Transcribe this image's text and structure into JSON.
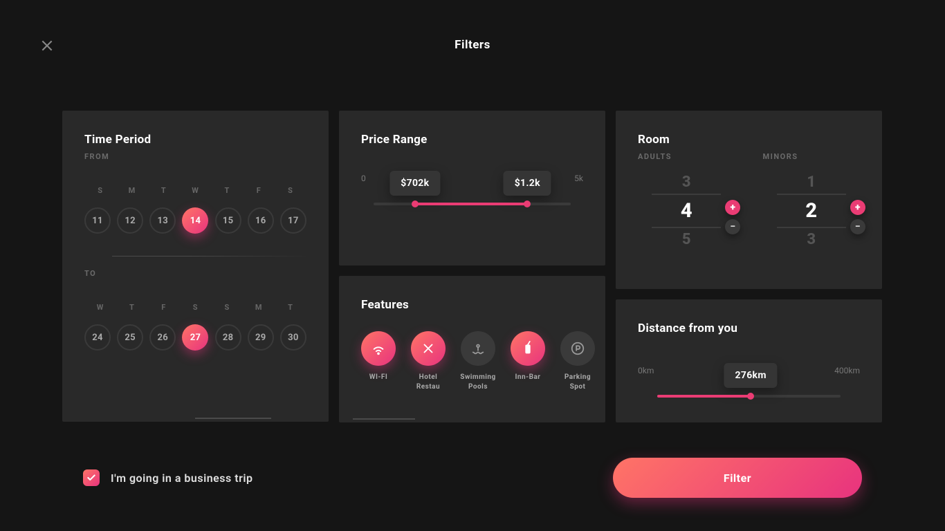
{
  "header": {
    "title": "Filters"
  },
  "timePeriod": {
    "title": "Time Period",
    "fromLabel": "FROM",
    "toLabel": "TO",
    "fromDows": [
      "S",
      "M",
      "T",
      "W",
      "T",
      "F",
      "S"
    ],
    "fromDays": [
      "11",
      "12",
      "13",
      "14",
      "15",
      "16",
      "17"
    ],
    "fromSelectedIndex": 3,
    "toDows": [
      "W",
      "T",
      "F",
      "S",
      "S",
      "M",
      "T"
    ],
    "toDays": [
      "24",
      "25",
      "26",
      "27",
      "28",
      "29",
      "30"
    ],
    "toSelectedIndex": 3
  },
  "priceRange": {
    "title": "Price Range",
    "minLabel": "0",
    "maxLabel": "5k",
    "lowValue": "$702k",
    "highValue": "$1.2k",
    "lowPercent": 21,
    "highPercent": 78
  },
  "features": {
    "title": "Features",
    "items": [
      {
        "label": "WI-FI",
        "on": true,
        "icon": "wifi"
      },
      {
        "label": "Hotel Restau",
        "on": true,
        "icon": "restaurant"
      },
      {
        "label": "Swimming Pools",
        "on": false,
        "icon": "pool"
      },
      {
        "label": "Inn-Bar",
        "on": true,
        "icon": "drink"
      },
      {
        "label": "Parking Spot",
        "on": false,
        "icon": "parking"
      }
    ]
  },
  "room": {
    "title": "Room",
    "adultsLabel": "ADULTS",
    "minorsLabel": "MINORS",
    "adults": {
      "prev": "3",
      "current": "4",
      "next": "5"
    },
    "minors": {
      "prev": "1",
      "current": "2",
      "next": "3"
    }
  },
  "distance": {
    "title": "Distance from you",
    "minLabel": "0km",
    "maxLabel": "400km",
    "value": "276km",
    "percent": 51
  },
  "bottom": {
    "checkboxLabel": "I'm going in a business trip",
    "checked": true,
    "filterLabel": "Filter"
  }
}
